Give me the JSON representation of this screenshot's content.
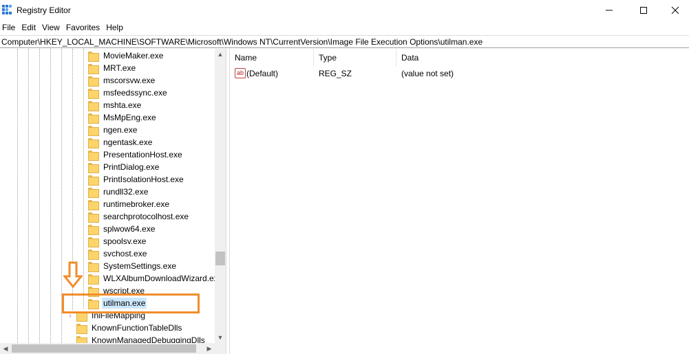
{
  "window": {
    "title": "Registry Editor",
    "icon": "registry-icon",
    "controls": [
      "minimize-icon",
      "maximize-icon",
      "close-icon"
    ]
  },
  "menu": [
    "File",
    "Edit",
    "View",
    "Favorites",
    "Help"
  ],
  "address": "Computer\\HKEY_LOCAL_MACHINE\\SOFTWARE\\Microsoft\\Windows NT\\CurrentVersion\\Image File Execution Options\\utilman.exe",
  "tree": {
    "items": [
      "MovieMaker.exe",
      "MRT.exe",
      "mscorsvw.exe",
      "msfeedssync.exe",
      "mshta.exe",
      "MsMpEng.exe",
      "ngen.exe",
      "ngentask.exe",
      "PresentationHost.exe",
      "PrintDialog.exe",
      "PrintIsolationHost.exe",
      "rundll32.exe",
      "runtimebroker.exe",
      "searchprotocolhost.exe",
      "splwow64.exe",
      "spoolsv.exe",
      "svchost.exe",
      "SystemSettings.exe",
      "WLXAlbumDownloadWizard.exe",
      "wscript.exe",
      "utilman.exe"
    ],
    "selected": "utilman.exe",
    "siblings": [
      "IniFileMapping",
      "KnownFunctionTableDlls",
      "KnownManagedDebuggingDlls"
    ]
  },
  "list": {
    "columns": {
      "name": "Name",
      "type": "Type",
      "data": "Data"
    },
    "rows": [
      {
        "name": "(Default)",
        "type": "REG_SZ",
        "data": "(value not set)",
        "icon": "string-value-icon"
      }
    ]
  },
  "annotation": {
    "color": "#f28c28"
  }
}
